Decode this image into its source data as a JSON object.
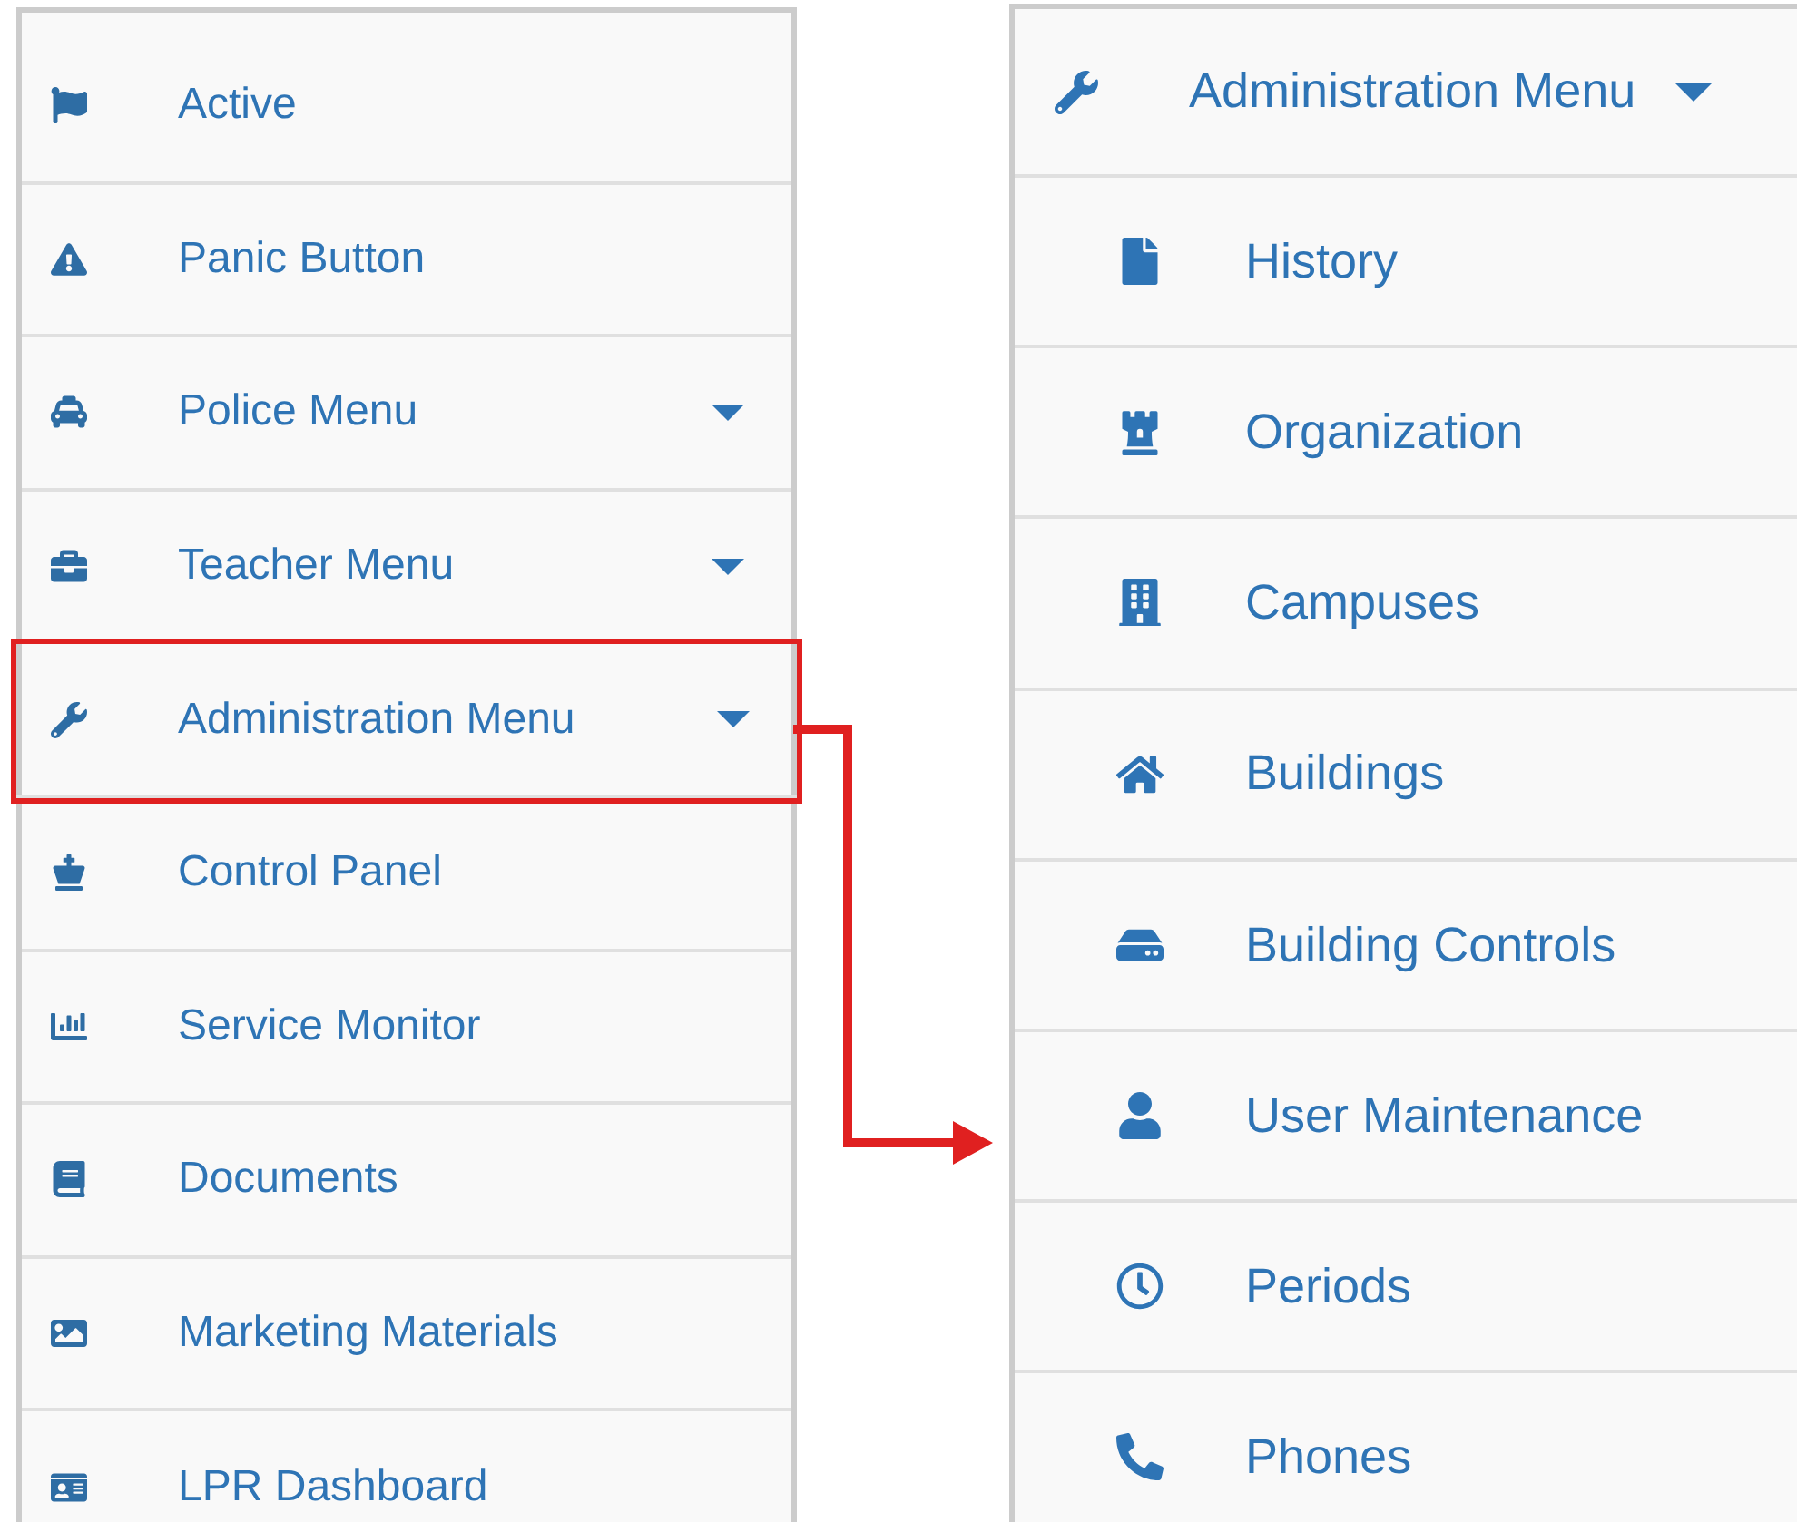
{
  "main_menu": {
    "items": [
      {
        "label": "Active",
        "has_submenu": false,
        "highlighted": false
      },
      {
        "label": "Panic Button",
        "has_submenu": false,
        "highlighted": false
      },
      {
        "label": "Police Menu",
        "has_submenu": true,
        "highlighted": false
      },
      {
        "label": "Teacher Menu",
        "has_submenu": true,
        "highlighted": false
      },
      {
        "label": "Administration Menu",
        "has_submenu": true,
        "highlighted": true
      },
      {
        "label": "Control Panel",
        "has_submenu": false,
        "highlighted": false
      },
      {
        "label": "Service Monitor",
        "has_submenu": false,
        "highlighted": false
      },
      {
        "label": "Documents",
        "has_submenu": false,
        "highlighted": false
      },
      {
        "label": "Marketing Materials",
        "has_submenu": false,
        "highlighted": false
      },
      {
        "label": "LPR Dashboard",
        "has_submenu": false,
        "highlighted": false
      }
    ]
  },
  "submenu": {
    "title": "Administration Menu",
    "expanded": true,
    "items": [
      {
        "label": "History"
      },
      {
        "label": "Organization"
      },
      {
        "label": "Campuses"
      },
      {
        "label": "Buildings"
      },
      {
        "label": "Building Controls"
      },
      {
        "label": "User Maintenance"
      },
      {
        "label": "Periods"
      },
      {
        "label": "Phones"
      }
    ]
  }
}
